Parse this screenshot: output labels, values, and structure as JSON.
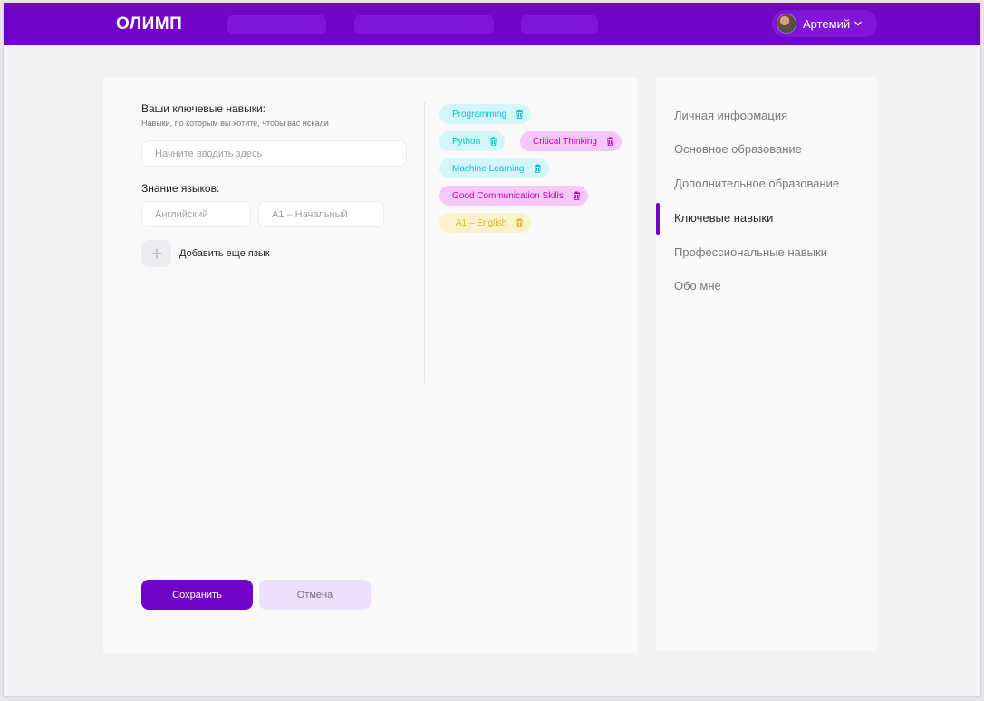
{
  "header": {
    "logo": "ОЛИМП",
    "user_name": "Артемий"
  },
  "skills_form": {
    "title": "Ваши ключевые навыки:",
    "subtitle": "Навыки, по которым вы хотите, чтобы вас искали",
    "skills_input": {
      "placeholder": "Начните вводить здесь",
      "value": ""
    },
    "languages_title": "Знание языков:",
    "language_select": {
      "placeholder": "Английский"
    },
    "level_select": {
      "placeholder": "A1 – Начальный"
    },
    "add_language_label": "Добавить еще язык"
  },
  "tags": [
    {
      "label": "Programming",
      "color": "#0cc1cc"
    },
    {
      "label": "Python",
      "color": "#0cc1cc"
    },
    {
      "label": "Critical Thinking",
      "color": "#c400c9"
    },
    {
      "label": "Machine Learning",
      "color": "#0cc1cc"
    },
    {
      "label": "Good Communication Skills",
      "color": "#c400c9"
    },
    {
      "label": "A1 – English",
      "color": "#e3b21e"
    }
  ],
  "actions": {
    "save_label": "Сохранить",
    "cancel_label": "Отмена"
  },
  "side_menu": {
    "items": [
      {
        "label": "Личная информация"
      },
      {
        "label": "Основное образование"
      },
      {
        "label": "Дополнительное образование"
      },
      {
        "label": "Ключевые навыки",
        "active": true
      },
      {
        "label": "Профессиональные навыки"
      },
      {
        "label": "Обо мне"
      }
    ]
  },
  "colors": {
    "brand": "#7005c6",
    "cyan": "#0cc1cc",
    "magenta": "#c400c9",
    "yellow": "#e3b21e"
  },
  "icons": [
    "avatar",
    "chevron-down-icon",
    "plus-icon",
    "trash-icon"
  ]
}
